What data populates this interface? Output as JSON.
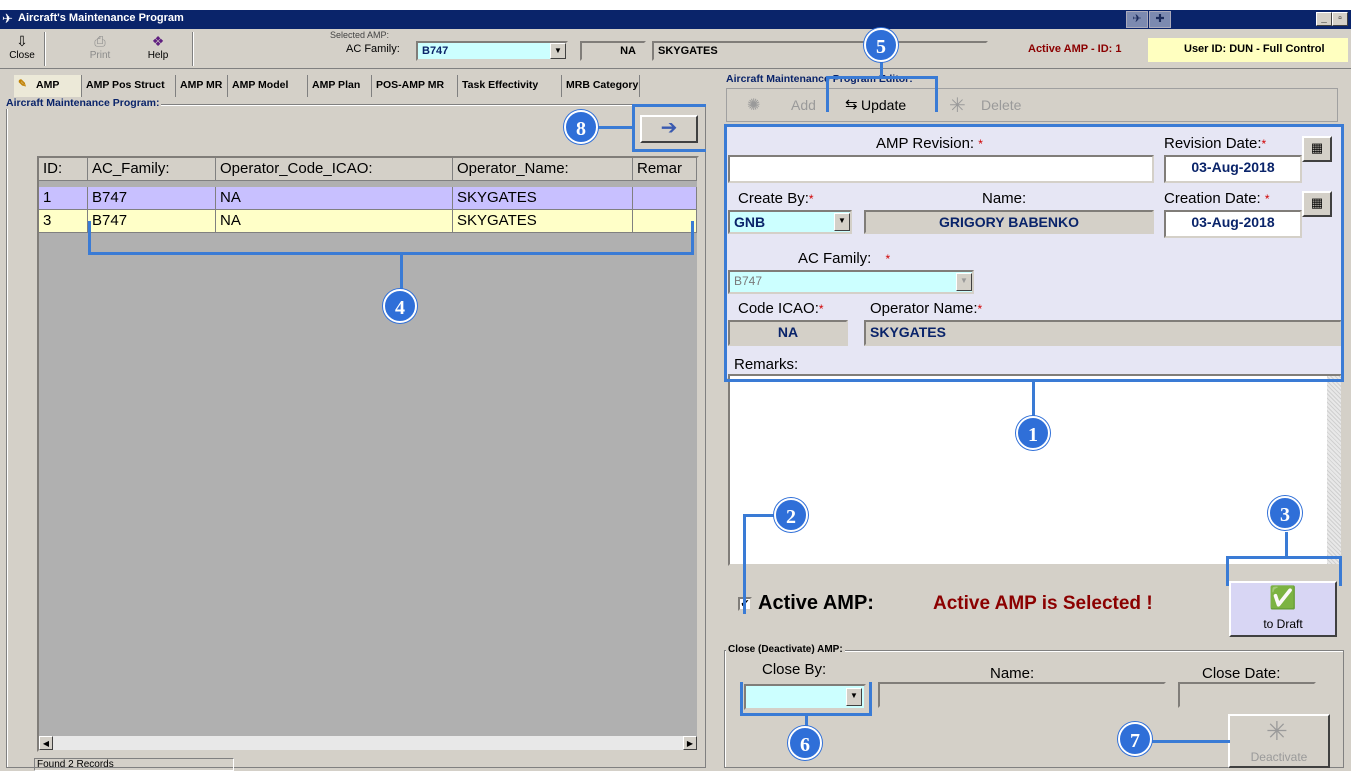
{
  "window": {
    "title": "Aircraft's Maintenance Program",
    "min_label": "_",
    "restore_label": "▫"
  },
  "toolbar": {
    "close_label": "Close",
    "print_label": "Print",
    "help_label": "Help",
    "selected_amp_caption": "Selected AMP:",
    "ac_family_label": "AC Family:",
    "ac_family_value": "B747",
    "operator_code_value": "NA",
    "operator_name_value": "SKYGATES",
    "active_amp_text": "Active AMP - ID: 1",
    "user_text": "User ID: DUN - Full Control"
  },
  "tabs": [
    "AMP",
    "AMP Pos Struct",
    "AMP MR",
    "AMP Model",
    "AMP Plan",
    "POS-AMP MR",
    "Task Effectivity",
    "MRB Category"
  ],
  "left": {
    "frame_title": "Aircraft Maintenance Program:",
    "grid": {
      "columns": [
        "ID:",
        "AC_Family:",
        "Operator_Code_ICAO:",
        "Operator_Name:",
        "Remar"
      ],
      "rows": [
        [
          "1",
          "B747",
          "NA",
          "SKYGATES",
          ""
        ],
        [
          "3",
          "B747",
          "NA",
          "SKYGATES",
          ""
        ]
      ]
    },
    "status": "Found 2 Records"
  },
  "editor": {
    "frame_title": "Aircraft Maintenance Program Editor:",
    "add_label": "Add",
    "update_label": "Update",
    "delete_label": "Delete",
    "amp_revision_label": "AMP Revision:",
    "amp_revision_value": "",
    "revision_date_label": "Revision Date:",
    "revision_date_value": "03-Aug-2018",
    "create_by_label": "Create By:",
    "create_by_value": "GNB",
    "name_label": "Name:",
    "name_value": "GRIGORY BABENKO",
    "creation_date_label": "Creation Date:",
    "creation_date_value": "03-Aug-2018",
    "ac_family_label": "AC Family:",
    "ac_family_value": "B747",
    "code_icao_label": "Code ICAO:",
    "code_icao_value": "NA",
    "operator_name_label": "Operator Name:",
    "operator_name_value": "SKYGATES",
    "remarks_label": "Remarks:",
    "remarks_value": "",
    "active_amp_label": "Active AMP:",
    "active_amp_status": "Active AMP is Selected !",
    "to_draft_label": "to Draft",
    "required_mark": "*"
  },
  "close_section": {
    "frame_title": "Close (Deactivate) AMP:",
    "close_by_label": "Close By:",
    "name_label": "Name:",
    "close_date_label": "Close Date:",
    "deactivate_label": "Deactivate"
  },
  "callouts": [
    "1",
    "2",
    "3",
    "4",
    "5",
    "6",
    "7",
    "8"
  ],
  "colors": {
    "accent": "#3a7bd5",
    "titlebar": "#0a246a",
    "required": "#d00000",
    "status_text": "#8b0000"
  }
}
